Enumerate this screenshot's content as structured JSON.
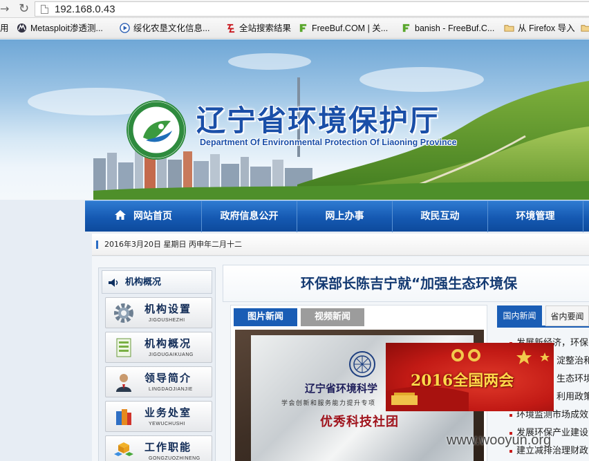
{
  "browser": {
    "url": "192.168.0.43",
    "bookmarks": [
      {
        "label": "用",
        "icon": "bookmark-toolbar-icon"
      },
      {
        "label": "Metasploit渗透测...",
        "icon": "metasploit-favicon-icon"
      },
      {
        "label": "绥化农垦文化信息...",
        "icon": "media-play-favicon-icon"
      },
      {
        "label": "全站搜索结果",
        "icon": "red-character-favicon-icon"
      },
      {
        "label": "FreeBuf.COM | 关...",
        "icon": "freebuf-favicon-icon"
      },
      {
        "label": "banish - FreeBuf.C...",
        "icon": "freebuf-favicon-icon"
      },
      {
        "label": "从 Firefox 导入",
        "icon": "folder-icon"
      }
    ]
  },
  "site": {
    "title": "辽宁省环境保护厅",
    "subtitle": "Department Of Environmental Protection Of Liaoning Province",
    "nav": [
      "网站首页",
      "政府信息公开",
      "网上办事",
      "政民互动",
      "环境管理"
    ],
    "date": "2016年3月20日 星期日 丙申年二月十二",
    "sidebar": {
      "header": "机构概况",
      "items": [
        {
          "label": "机构设置",
          "pinyin": "JIGOUSHEZHI",
          "icon": "gear-icon"
        },
        {
          "label": "机构概况",
          "pinyin": "JIGOUGAIKUANG",
          "icon": "document-list-icon"
        },
        {
          "label": "领导简介",
          "pinyin": "LINGDAOJIANJIE",
          "icon": "person-icon"
        },
        {
          "label": "业务处室",
          "pinyin": "YEWUCHUSHI",
          "icon": "office-books-icon"
        },
        {
          "label": "工作职能",
          "pinyin": "GONGZUOZHINENG",
          "icon": "cubes-icon"
        }
      ]
    },
    "headline": "环保部长陈吉宁就“加强生态环境保",
    "photo_tabs": [
      "图片新闻",
      "视频新闻"
    ],
    "photo_plaque": {
      "title": "辽宁省环境科学",
      "subtitle": "学会创新和服务能力提升专项",
      "award": "优秀科技社团"
    },
    "news_tabs": [
      "国内新闻",
      "省内要闻"
    ],
    "news_items": [
      "发展新经济，环保",
      "淀整治和",
      "生态环境",
      "利用政策",
      "环境监测市场成效",
      "发展环保产业建设",
      "建立减排治理财政"
    ],
    "ad_banner": "2016全国两会",
    "watermark": "www.wooyun.org"
  },
  "colors": {
    "nav_blue": "#1559b2",
    "headline_blue": "#143a72",
    "tab_active": "#1a5db5",
    "tab_inactive": "#9c9c9c",
    "ad_red": "#c21a15"
  }
}
